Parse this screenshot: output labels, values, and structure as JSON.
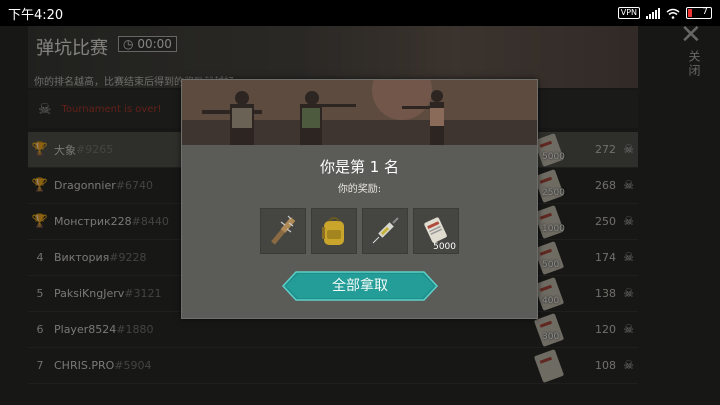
{
  "status_bar": {
    "time": "下午4:20",
    "vpn": "VPN",
    "battery": "7"
  },
  "header": {
    "title": "弹坑比赛",
    "timer": "00:00",
    "description": "你的排名越高，比赛结束后得到的奖励就越好"
  },
  "tournament_status": "Tournament is over!",
  "close": {
    "icon": "close-icon",
    "label": "关闭"
  },
  "leaderboard": [
    {
      "rank": "1",
      "trophy": "gold",
      "name": "大象",
      "tag": "#9265",
      "reward": "5000",
      "score": "272",
      "me": true
    },
    {
      "rank": "2",
      "trophy": "silver",
      "name": "Dragonnier",
      "tag": "#6740",
      "reward": "2500",
      "score": "268"
    },
    {
      "rank": "3",
      "trophy": "bronze",
      "name": "Монстрик228",
      "tag": "#8440",
      "reward": "1000",
      "score": "250"
    },
    {
      "rank": "4",
      "trophy": "",
      "name": "Виктория",
      "tag": "#9228",
      "reward": "500",
      "score": "174"
    },
    {
      "rank": "5",
      "trophy": "",
      "name": "PaksiKngJerv",
      "tag": "#3121",
      "reward": "400",
      "score": "138"
    },
    {
      "rank": "6",
      "trophy": "",
      "name": "Player8524",
      "tag": "#1880",
      "reward": "300",
      "score": "120"
    },
    {
      "rank": "7",
      "trophy": "",
      "name": "CHRIS.PRO",
      "tag": "#5904",
      "reward": "",
      "score": "108"
    }
  ],
  "modal": {
    "place_text": "你是第 1 名",
    "reward_label": "你的奖励:",
    "items": [
      {
        "icon": "spiked-club-icon",
        "count": ""
      },
      {
        "icon": "backpack-icon",
        "count": ""
      },
      {
        "icon": "syringe-icon",
        "count": ""
      },
      {
        "icon": "ticket-icon",
        "count": "5000"
      }
    ],
    "claim_label": "全部拿取"
  },
  "colors": {
    "accent": "#26a39e",
    "danger": "#b23b2e"
  }
}
